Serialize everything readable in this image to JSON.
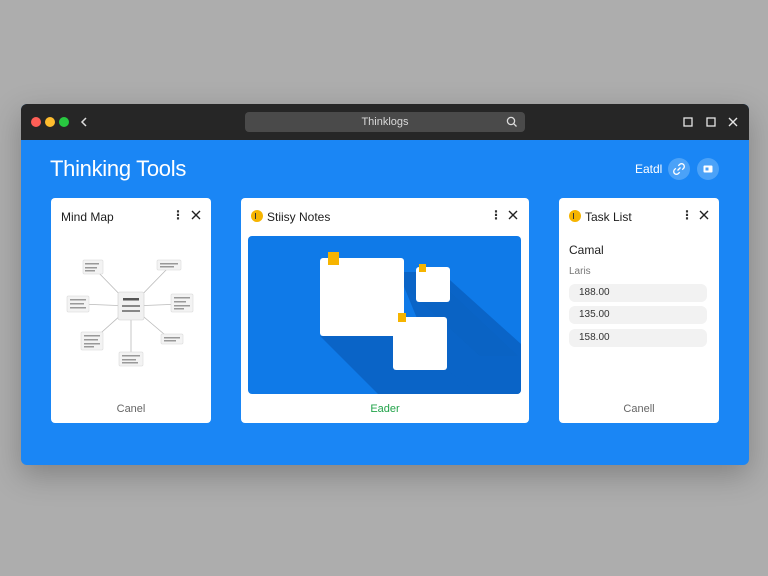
{
  "titlebar": {
    "address_text": "Thinklogs",
    "icons": [
      "back-icon",
      "search-icon",
      "maximize-icon",
      "restore-icon",
      "close-icon"
    ]
  },
  "header": {
    "title": "Thinking Tools",
    "link_label": "Eatdl",
    "actions": [
      "link-icon",
      "window-icon"
    ]
  },
  "cards": {
    "mind_map": {
      "title": "Mind Map",
      "menu": "⋮",
      "footer": "Canel"
    },
    "sticky_notes": {
      "title": "Stiisy Notes",
      "menu": "⋮",
      "footer": "Eader"
    },
    "task_list": {
      "title": "Task List",
      "menu": "⋮",
      "subtitle": "Camal",
      "label": "Laris",
      "items": [
        "188.00",
        "135.00",
        "158.00"
      ],
      "footer": "Canell"
    }
  },
  "colors": {
    "page_background": "#adadad",
    "titlebar": "#262626",
    "accent_blue": "#1a86f5",
    "stage_blue": "#0f7ae8",
    "note_pin": "#f6b400",
    "footer_green": "#22a34a"
  }
}
